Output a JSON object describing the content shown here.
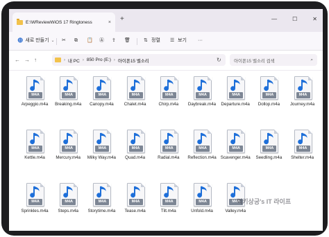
{
  "window": {
    "tab_title": "E:\\WReviewWiOS 17 Ringtoness",
    "tab_close": "×",
    "new_tab": "+",
    "controls": [
      "—",
      "☐",
      "✕"
    ]
  },
  "toolbar": {
    "new_label": "새로 만들기",
    "sort_label": "정렬",
    "view_label": "보기",
    "more_label": "···"
  },
  "address": {
    "crumbs": [
      "내 PC",
      "850 Pro (E:)",
      "아이폰15 벨소리"
    ],
    "search_placeholder": "아이폰15 벨소리 검색"
  },
  "files": [
    {
      "name": "Arpeggio.m4a",
      "badge": "M4A"
    },
    {
      "name": "Breaking.m4a",
      "badge": "M4A"
    },
    {
      "name": "Canopy.m4a",
      "badge": "M4A"
    },
    {
      "name": "Chalet.m4a",
      "badge": "M4A"
    },
    {
      "name": "Chirp.m4a",
      "badge": "M4A"
    },
    {
      "name": "Daybreak.m4a",
      "badge": "M4A"
    },
    {
      "name": "Departure.m4a",
      "badge": "M4A"
    },
    {
      "name": "Dollop.m4a",
      "badge": "M4A"
    },
    {
      "name": "Journey.m4a",
      "badge": "M4A"
    },
    {
      "name": "Kettle.m4a",
      "badge": "M4A"
    },
    {
      "name": "Mercury.m4a",
      "badge": "M4A"
    },
    {
      "name": "Milky Way.m4a",
      "badge": "M4A"
    },
    {
      "name": "Quad.m4a",
      "badge": "M4A"
    },
    {
      "name": "Radial.m4a",
      "badge": "M4A"
    },
    {
      "name": "Reflection.m4a",
      "badge": "M4A"
    },
    {
      "name": "Scavenger.m4a",
      "badge": "M4A"
    },
    {
      "name": "Seedling.m4a",
      "badge": "M4A"
    },
    {
      "name": "Shelter.m4a",
      "badge": "M4A"
    },
    {
      "name": "Sprinkles.m4a",
      "badge": "M4A"
    },
    {
      "name": "Steps.m4a",
      "badge": "M4A"
    },
    {
      "name": "Storytime.m4a",
      "badge": "M4A"
    },
    {
      "name": "Tease.m4a",
      "badge": "M4A"
    },
    {
      "name": "Tilt.m4a",
      "badge": "M4A"
    },
    {
      "name": "Unfold.m4a",
      "badge": "M4A"
    },
    {
      "name": "Valley.m4a",
      "badge": "M4A"
    }
  ],
  "watermark": "럭키상궁's IT 라이프",
  "colors": {
    "note_blue": "#1e6fd9",
    "folder": "#f2c24b"
  }
}
